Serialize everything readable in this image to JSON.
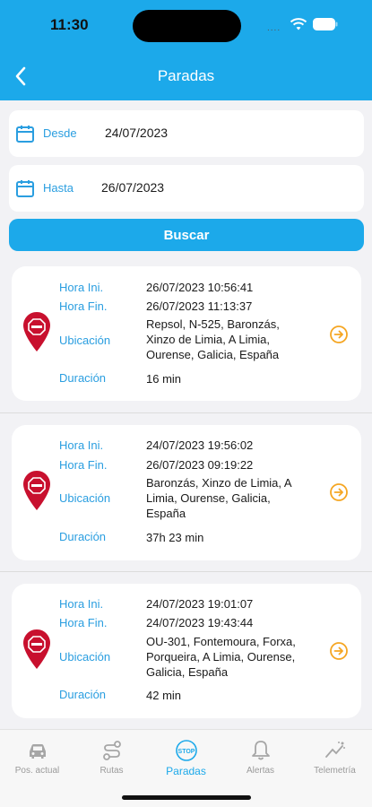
{
  "status": {
    "time": "11:30",
    "dots": "...."
  },
  "header": {
    "title": "Paradas",
    "back_icon": "chevron-left-icon"
  },
  "filters": {
    "desde_label": "Desde",
    "desde_value": "24/07/2023",
    "hasta_label": "Hasta",
    "hasta_value": "26/07/2023",
    "search_label": "Buscar"
  },
  "labels": {
    "start": "Hora Ini.",
    "end": "Hora Fin.",
    "location": "Ubicación",
    "duration": "Duración"
  },
  "stops": [
    {
      "start": "26/07/2023 10:56:41",
      "end": "26/07/2023 11:13:37",
      "location": [
        "Repsol, N-525, Baronzás,",
        "Xinzo de Limia, A Limia,",
        "Ourense, Galicia, España"
      ],
      "duration": "16 min"
    },
    {
      "start": "24/07/2023 19:56:02",
      "end": "26/07/2023 09:19:22",
      "location": [
        "Baronzás, Xinzo de Limia, A",
        "Limia, Ourense, Galicia,",
        "España"
      ],
      "duration": "37h 23 min"
    },
    {
      "start": "24/07/2023 19:01:07",
      "end": "24/07/2023 19:43:44",
      "location": [
        "OU-301, Fontemoura, Forxa,",
        "Porqueira, A Limia, Ourense,",
        "Galicia, España"
      ],
      "duration": "42 min"
    }
  ],
  "tabs": [
    {
      "label": "Pos. actual",
      "icon": "car-icon"
    },
    {
      "label": "Rutas",
      "icon": "route-icon"
    },
    {
      "label": "Paradas",
      "icon": "stop-icon",
      "active": true
    },
    {
      "label": "Alertas",
      "icon": "bell-icon"
    },
    {
      "label": "Telemetría",
      "icon": "telemetry-icon"
    }
  ],
  "colors": {
    "primary": "#1ca9ea",
    "label_blue": "#2a9ee0",
    "pin_red": "#c8102e",
    "arrow_orange": "#f5a623"
  }
}
